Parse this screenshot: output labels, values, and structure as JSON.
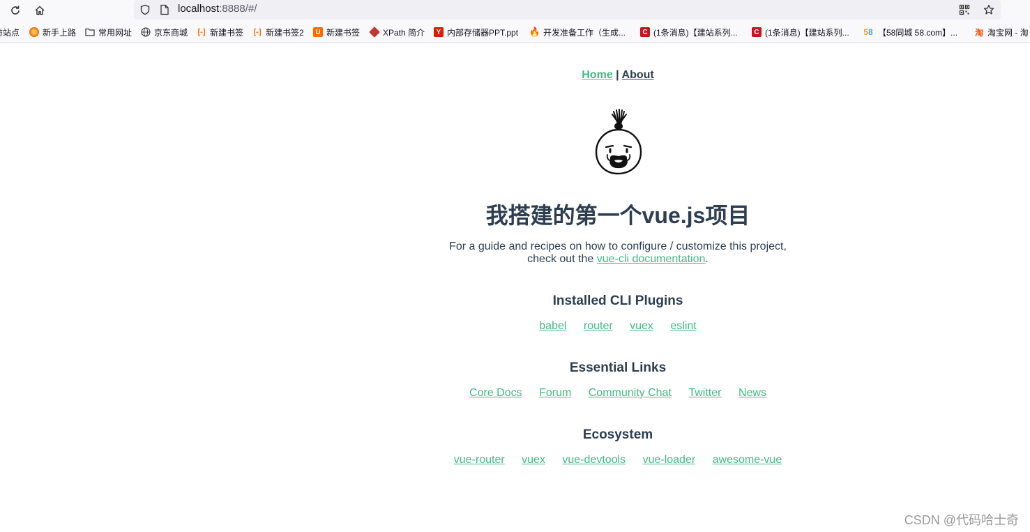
{
  "browser": {
    "url_host": "localhost",
    "url_path": ":8888/#/",
    "bookmarks": [
      {
        "label": "访站点",
        "icon": "globe-icon"
      },
      {
        "label": "新手上路",
        "icon": "firefox-icon"
      },
      {
        "label": "常用网址",
        "icon": "folder-icon"
      },
      {
        "label": "京东商城",
        "icon": "globe-icon"
      },
      {
        "label": "新建书签",
        "icon": "bracket-icon"
      },
      {
        "label": "新建书签2",
        "icon": "bracket-icon"
      },
      {
        "label": "新建书签",
        "icon": "u-icon"
      },
      {
        "label": "XPath 简介",
        "icon": "xpath-icon"
      },
      {
        "label": "内部存储器PPT.ppt",
        "icon": "doc-icon"
      },
      {
        "label": "开发准备工作（生成...",
        "icon": "flame-icon"
      },
      {
        "label": "(1条消息)【建站系列...",
        "icon": "csdn-icon"
      },
      {
        "label": "(1条消息)【建站系列...",
        "icon": "csdn-icon"
      },
      {
        "label": "【58同城 58.com】...",
        "icon": "58-icon"
      },
      {
        "label": "淘宝网 - 淘",
        "icon": "taobao-icon"
      }
    ]
  },
  "nav": {
    "home": "Home",
    "separator": "|",
    "about": "About"
  },
  "hero": {
    "title": "我搭建的第一个vue.js项目",
    "intro_line1": "For a guide and recipes on how to configure / customize this project,",
    "intro_line2_prefix": "check out the ",
    "intro_link": "vue-cli documentation",
    "intro_suffix": "."
  },
  "sections": [
    {
      "heading": "Installed CLI Plugins",
      "links": [
        "babel",
        "router",
        "vuex",
        "eslint"
      ]
    },
    {
      "heading": "Essential Links",
      "links": [
        "Core Docs",
        "Forum",
        "Community Chat",
        "Twitter",
        "News"
      ]
    },
    {
      "heading": "Ecosystem",
      "links": [
        "vue-router",
        "vuex",
        "vue-devtools",
        "vue-loader",
        "awesome-vue"
      ]
    }
  ],
  "watermark": "CSDN @代码哈士奇",
  "colors": {
    "accent": "#42b983",
    "text": "#2c3e50"
  }
}
